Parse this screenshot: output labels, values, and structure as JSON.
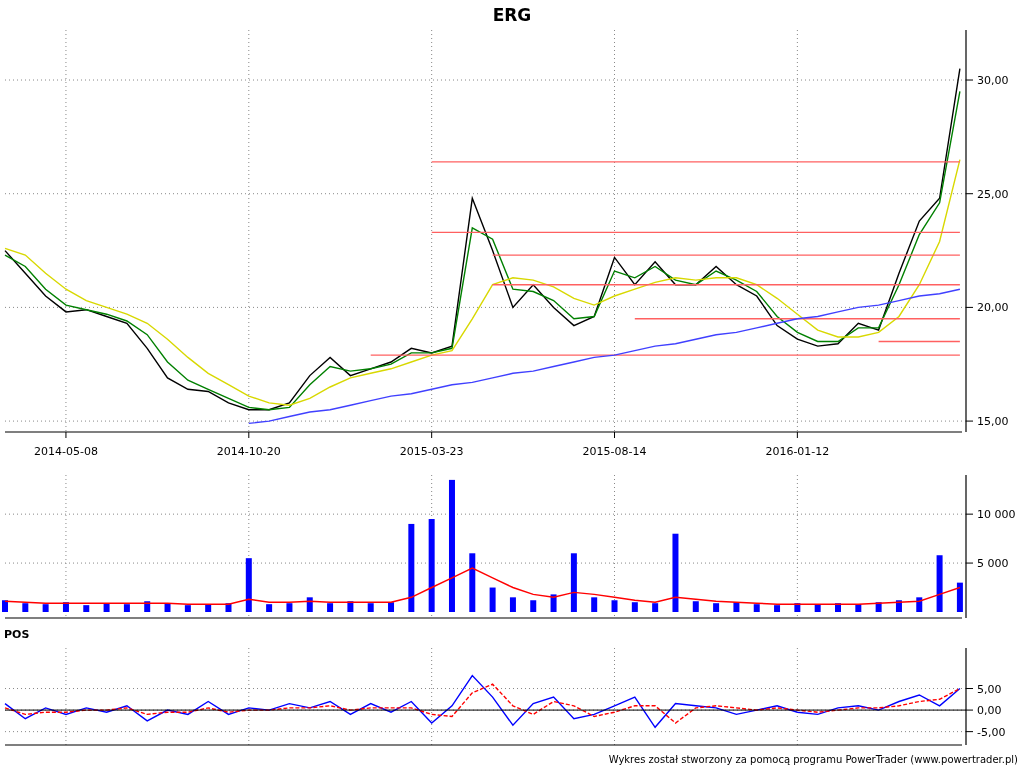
{
  "price_panel": {
    "chart_data": {
      "type": "line",
      "title": "ERG",
      "grid": true,
      "categories": [
        null,
        null,
        null,
        "2014-05-08",
        null,
        null,
        null,
        null,
        null,
        null,
        null,
        null,
        "2014-10-20",
        null,
        null,
        null,
        null,
        null,
        null,
        null,
        null,
        "2015-03-23",
        null,
        null,
        null,
        null,
        null,
        null,
        null,
        null,
        "2015-08-14",
        null,
        null,
        null,
        null,
        null,
        null,
        null,
        null,
        "2016-01-12",
        null,
        null,
        null,
        null,
        null,
        null,
        null,
        null
      ],
      "ylim": [
        14.52,
        32.2
      ],
      "yticks": [
        {
          "value": 15,
          "label": "15,00"
        },
        {
          "value": 20,
          "label": "20,00"
        },
        {
          "value": 25,
          "label": "25,00"
        },
        {
          "value": 30,
          "label": "30,00"
        }
      ],
      "series": [
        {
          "color": "#000000",
          "values": [
            22.5,
            21.5,
            20.5,
            19.8,
            19.9,
            19.6,
            19.3,
            18.2,
            16.9,
            16.4,
            16.3,
            15.8,
            15.5,
            15.5,
            15.8,
            17.0,
            17.8,
            17.0,
            17.3,
            17.6,
            18.2,
            18.0,
            18.3,
            24.8,
            22.5,
            20.0,
            21.0,
            20.0,
            19.2,
            19.6,
            22.2,
            21.0,
            22.0,
            21.0,
            21.0,
            21.8,
            21.0,
            20.5,
            19.2,
            18.6,
            18.3,
            18.4,
            19.3,
            19.0,
            21.5,
            23.8,
            24.8,
            30.5
          ]
        },
        {
          "color": "#008000",
          "values": [
            22.3,
            21.8,
            20.8,
            20.1,
            19.9,
            19.7,
            19.4,
            18.8,
            17.6,
            16.8,
            16.4,
            16.0,
            15.6,
            15.5,
            15.6,
            16.6,
            17.4,
            17.2,
            17.3,
            17.5,
            18.0,
            18.0,
            18.2,
            23.5,
            23.0,
            20.8,
            20.7,
            20.3,
            19.5,
            19.6,
            21.6,
            21.3,
            21.8,
            21.2,
            21.0,
            21.6,
            21.2,
            20.7,
            19.6,
            18.9,
            18.5,
            18.5,
            19.1,
            19.1,
            21.0,
            23.2,
            24.6,
            29.5
          ]
        },
        {
          "color": "#d8d800",
          "values": [
            22.6,
            22.3,
            21.5,
            20.8,
            20.3,
            20.0,
            19.7,
            19.3,
            18.6,
            17.8,
            17.1,
            16.6,
            16.1,
            15.8,
            15.7,
            16.0,
            16.5,
            16.9,
            17.1,
            17.3,
            17.6,
            17.9,
            18.1,
            19.5,
            21.0,
            21.3,
            21.2,
            20.9,
            20.4,
            20.1,
            20.5,
            20.8,
            21.1,
            21.3,
            21.2,
            21.3,
            21.3,
            21.0,
            20.4,
            19.7,
            19.0,
            18.7,
            18.7,
            18.9,
            19.6,
            21.0,
            22.9,
            26.5
          ]
        },
        {
          "color": "#ff6060",
          "values": [
            null,
            null,
            null,
            null,
            null,
            null,
            null,
            null,
            null,
            null,
            null,
            null,
            null,
            null,
            null,
            null,
            null,
            null,
            null,
            null,
            null,
            26.4,
            26.4,
            26.4,
            26.4,
            26.4,
            26.4,
            26.4,
            26.4,
            26.4,
            26.4,
            26.4,
            26.4,
            26.4,
            26.4,
            26.4,
            26.4,
            26.4,
            26.4,
            26.4,
            26.4,
            26.4,
            26.4,
            26.4,
            26.4,
            26.4,
            26.4,
            26.4
          ]
        },
        {
          "color": "#ff6060",
          "values": [
            null,
            null,
            null,
            null,
            null,
            null,
            null,
            null,
            null,
            null,
            null,
            null,
            null,
            null,
            null,
            null,
            null,
            null,
            null,
            null,
            null,
            23.3,
            23.3,
            23.3,
            23.3,
            23.3,
            23.3,
            23.3,
            23.3,
            23.3,
            23.3,
            23.3,
            23.3,
            23.3,
            23.3,
            23.3,
            23.3,
            23.3,
            23.3,
            23.3,
            23.3,
            23.3,
            23.3,
            23.3,
            23.3,
            23.3,
            23.3,
            23.3
          ]
        },
        {
          "color": "#ff6060",
          "values": [
            null,
            null,
            null,
            null,
            null,
            null,
            null,
            null,
            null,
            null,
            null,
            null,
            null,
            null,
            null,
            null,
            null,
            null,
            null,
            null,
            null,
            null,
            null,
            null,
            22.3,
            22.3,
            22.3,
            22.3,
            22.3,
            22.3,
            22.3,
            22.3,
            22.3,
            22.3,
            22.3,
            22.3,
            22.3,
            22.3,
            22.3,
            22.3,
            22.3,
            22.3,
            22.3,
            22.3,
            22.3,
            22.3,
            22.3,
            22.3
          ]
        },
        {
          "color": "#ff6060",
          "values": [
            null,
            null,
            null,
            null,
            null,
            null,
            null,
            null,
            null,
            null,
            null,
            null,
            null,
            null,
            null,
            null,
            null,
            null,
            null,
            null,
            null,
            null,
            null,
            null,
            21.0,
            21.0,
            21.0,
            21.0,
            21.0,
            21.0,
            21.0,
            21.0,
            21.0,
            21.0,
            21.0,
            21.0,
            21.0,
            21.0,
            21.0,
            21.0,
            21.0,
            21.0,
            21.0,
            21.0,
            21.0,
            21.0,
            21.0,
            21.0
          ]
        },
        {
          "color": "#ff6060",
          "values": [
            null,
            null,
            null,
            null,
            null,
            null,
            null,
            null,
            null,
            null,
            null,
            null,
            null,
            null,
            null,
            null,
            null,
            null,
            null,
            null,
            null,
            null,
            null,
            null,
            null,
            null,
            null,
            null,
            null,
            null,
            null,
            19.5,
            19.5,
            19.5,
            19.5,
            19.5,
            19.5,
            19.5,
            19.5,
            19.5,
            19.5,
            19.5,
            19.5,
            19.5,
            19.5,
            19.5,
            19.5,
            19.5
          ]
        },
        {
          "color": "#ff6060",
          "values": [
            null,
            null,
            null,
            null,
            null,
            null,
            null,
            null,
            null,
            null,
            null,
            null,
            null,
            null,
            null,
            null,
            null,
            null,
            null,
            null,
            null,
            null,
            null,
            null,
            null,
            null,
            null,
            null,
            null,
            null,
            null,
            null,
            null,
            null,
            null,
            null,
            null,
            null,
            null,
            null,
            null,
            null,
            null,
            18.5,
            18.5,
            18.5,
            18.5,
            18.5
          ]
        },
        {
          "color": "#ff6060",
          "values": [
            null,
            null,
            null,
            null,
            null,
            null,
            null,
            null,
            null,
            null,
            null,
            null,
            null,
            null,
            null,
            null,
            null,
            null,
            17.9,
            17.9,
            17.9,
            17.9,
            17.9,
            17.9,
            17.9,
            17.9,
            17.9,
            17.9,
            17.9,
            17.9,
            17.9,
            17.9,
            17.9,
            17.9,
            17.9,
            17.9,
            17.9,
            17.9,
            17.9,
            17.9,
            17.9,
            17.9,
            17.9,
            17.9,
            17.9,
            17.9,
            17.9,
            17.9
          ]
        },
        {
          "color": "#4040ff",
          "values": [
            null,
            null,
            null,
            null,
            null,
            null,
            null,
            null,
            null,
            null,
            null,
            null,
            14.9,
            15.0,
            15.2,
            15.4,
            15.5,
            15.7,
            15.9,
            16.1,
            16.2,
            16.4,
            16.6,
            16.7,
            16.9,
            17.1,
            17.2,
            17.4,
            17.6,
            17.8,
            17.9,
            18.1,
            18.3,
            18.4,
            18.6,
            18.8,
            18.9,
            19.1,
            19.3,
            19.5,
            19.6,
            19.8,
            20.0,
            20.1,
            20.3,
            20.5,
            20.6,
            20.8
          ]
        }
      ]
    }
  },
  "volume_panel": {
    "chart_data": {
      "type": "bar",
      "grid": true,
      "ylim": [
        0,
        14000
      ],
      "yticks": [
        {
          "value": 5000,
          "label": "5 000"
        },
        {
          "value": 10000,
          "label": "10 000"
        }
      ],
      "series": [
        {
          "color": "#0000ff",
          "type": "bar",
          "values": [
            1200,
            900,
            800,
            1000,
            700,
            900,
            800,
            1100,
            900,
            700,
            800,
            900,
            5500,
            800,
            900,
            1500,
            900,
            1100,
            900,
            1000,
            9000,
            9500,
            13500,
            6000,
            2500,
            1500,
            1200,
            1800,
            6000,
            1500,
            1200,
            1000,
            900,
            8000,
            1100,
            900,
            1000,
            800,
            700,
            900,
            800,
            900,
            800,
            1000,
            1200,
            1500,
            5800,
            3000
          ]
        },
        {
          "color": "#ff0000",
          "type": "line",
          "values": [
            1100,
            1000,
            900,
            900,
            900,
            900,
            900,
            900,
            900,
            800,
            800,
            800,
            1300,
            1000,
            1000,
            1100,
            1000,
            1000,
            1000,
            1000,
            1500,
            2500,
            3500,
            4500,
            3500,
            2500,
            1800,
            1500,
            2000,
            1800,
            1500,
            1200,
            1000,
            1500,
            1300,
            1100,
            1000,
            900,
            800,
            800,
            800,
            800,
            800,
            900,
            1000,
            1100,
            1800,
            2500
          ]
        }
      ]
    }
  },
  "pos_panel": {
    "chart_data": {
      "type": "line",
      "title": "POS",
      "grid": true,
      "ylim": [
        -8.1,
        14.4
      ],
      "yticks": [
        {
          "value": -5,
          "label": "-5,00"
        },
        {
          "value": 0,
          "label": "0,00"
        },
        {
          "value": 5,
          "label": "5,00"
        }
      ],
      "series": [
        {
          "color": "#0000ff",
          "line_style": "solid",
          "values": [
            1.5,
            -2.0,
            0.5,
            -1.0,
            0.5,
            -0.5,
            1.0,
            -2.5,
            0.0,
            -1.0,
            2.0,
            -1.0,
            0.5,
            0.0,
            1.5,
            0.5,
            2.0,
            -1.0,
            1.5,
            -0.5,
            2.0,
            -3.0,
            1.0,
            8.0,
            3.0,
            -3.5,
            1.5,
            3.0,
            -2.0,
            -1.0,
            1.0,
            3.0,
            -4.0,
            1.5,
            1.0,
            0.5,
            -1.0,
            0.0,
            1.0,
            -0.5,
            -1.0,
            0.5,
            1.0,
            0.0,
            2.0,
            3.5,
            1.0,
            5.0
          ]
        },
        {
          "color": "#ff0000",
          "line_style": "dashed",
          "values": [
            0.5,
            -1.0,
            -0.5,
            -0.5,
            0.0,
            0.0,
            0.5,
            -1.0,
            -0.5,
            -0.5,
            0.5,
            -0.5,
            0.0,
            0.0,
            0.5,
            0.5,
            1.0,
            0.0,
            0.5,
            0.5,
            0.5,
            -1.0,
            -1.5,
            4.0,
            6.0,
            1.0,
            -1.0,
            2.0,
            1.0,
            -1.5,
            -0.5,
            1.0,
            1.0,
            -3.0,
            0.5,
            1.0,
            0.5,
            0.0,
            0.5,
            0.0,
            -0.5,
            0.0,
            0.5,
            0.5,
            1.0,
            2.0,
            2.5,
            5.0
          ]
        }
      ]
    }
  },
  "footer": "Wykres został stworzony za pomocą programu PowerTrader (www.powertrader.pl)"
}
